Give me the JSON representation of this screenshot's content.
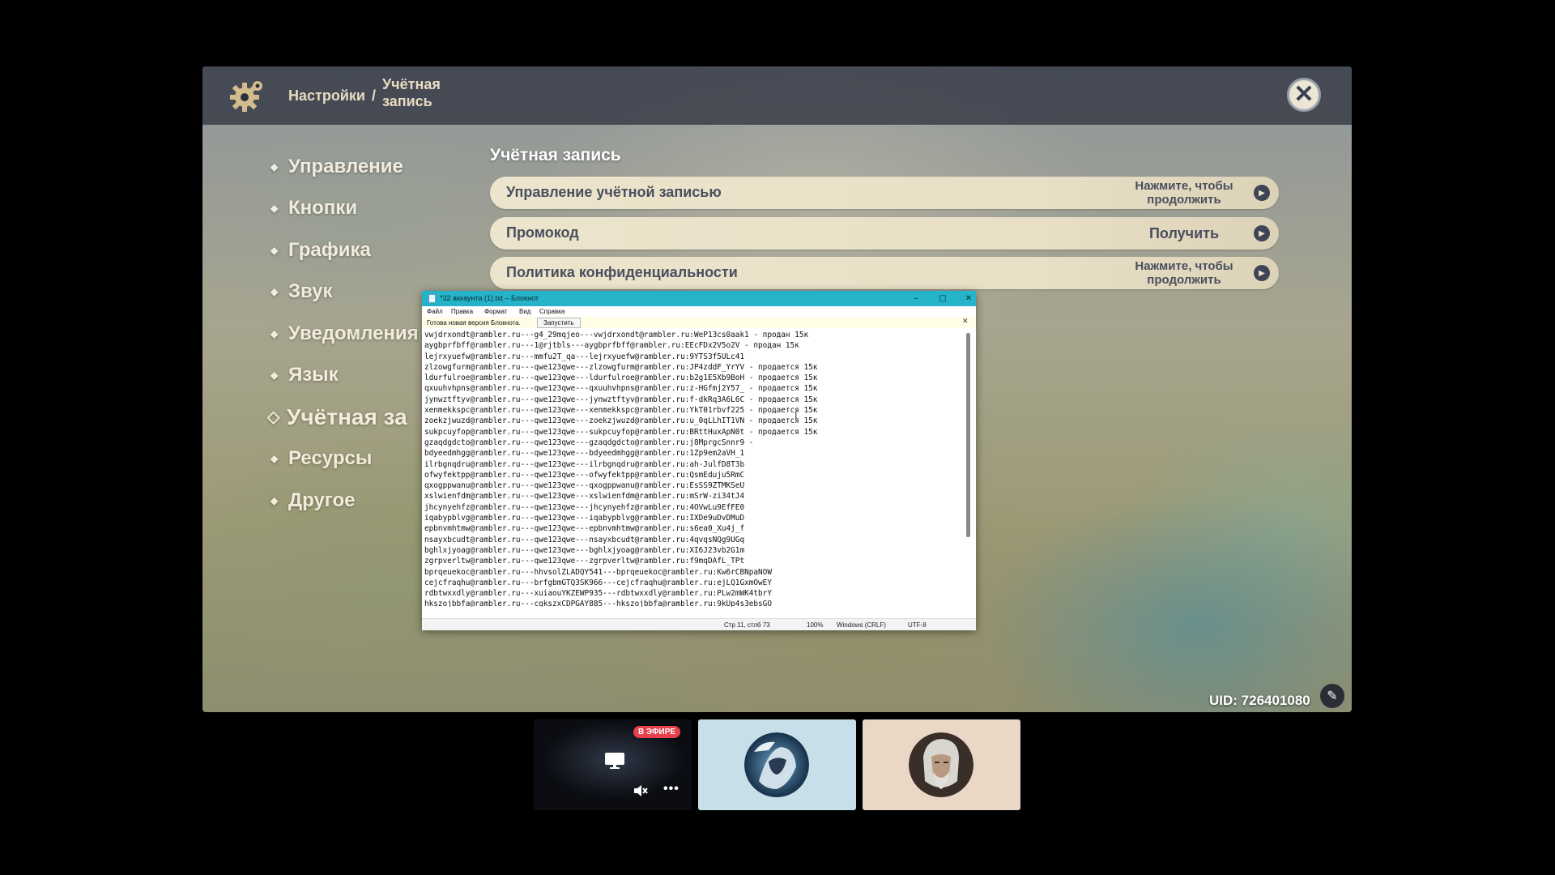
{
  "header": {
    "crumb_root": "Настройки",
    "crumb_sep": "/",
    "crumb_current": "Учётная запись"
  },
  "menu": {
    "items": [
      {
        "label": "Управление",
        "active": false
      },
      {
        "label": "Кнопки",
        "active": false
      },
      {
        "label": "Графика",
        "active": false
      },
      {
        "label": "Звук",
        "active": false
      },
      {
        "label": "Уведомления",
        "active": false
      },
      {
        "label": "Язык",
        "active": false
      },
      {
        "label": "Учётная за",
        "active": true
      },
      {
        "label": "Ресурсы",
        "active": false
      },
      {
        "label": "Другое",
        "active": false
      }
    ]
  },
  "section": {
    "title": "Учётная запись",
    "options": [
      {
        "label": "Управление учётной записью",
        "action": "Нажмите, чтобы продолжить"
      },
      {
        "label": "Промокод",
        "action": "Получить"
      },
      {
        "label": "Политика конфиденциальности",
        "action": "Нажмите, чтобы продолжить"
      }
    ]
  },
  "uid": "UID: 726401080",
  "notepad": {
    "title": "*32 аккаунта (1).txt – Блокнот",
    "menu": [
      "Файл",
      "Правка",
      "Формат",
      "Вид",
      "Справка"
    ],
    "notice": "Готова новая версия Блокнота.",
    "notice_button": "Запустить",
    "lines": [
      "vwjdrxondt@rambler.ru---g4_29mqjeo---vwjdrxondt@rambler.ru:WeP13cs0aak1 - продан 15к",
      "aygbprfbff@rambler.ru---1@rjtbls---aygbprfbff@rambler.ru:EEcFDx2V5o2V - продан 15к",
      "lejrxyuefw@rambler.ru---mmfu2T_qa---lejrxyuefw@rambler.ru:9YTS3f5ULc41",
      "zlzowgfurm@rambler.ru---qwe123qwe---zlzowgfurm@rambler.ru:JP4zddF_YrYV - продается 15к",
      "ldurfulroe@rambler.ru---qwe123qwe---ldurfulroe@rambler.ru:b2g1E5Xb9BoH - продается 15к",
      "qxuuhvhpns@rambler.ru---qwe123qwe---qxuuhvhpns@rambler.ru:z-HGfmj2Y57_ - продается 15к",
      "jynwztftyv@rambler.ru---qwe123qwe---jynwztftyv@rambler.ru:f-dkRq3A6L6C - продается 15к",
      "xenmekkspc@rambler.ru---qwe123qwe---xenmekkspc@rambler.ru:YkT01rbvf225 - продается 15к",
      "zoekzjwuzd@rambler.ru---qwe123qwe---zoekzjwuzd@rambler.ru:u_0qLLhIT1VN - продается 15к",
      "sukpcuyfop@rambler.ru---qwe123qwe---sukpcuyfop@rambler.ru:BRttHuxApN0t - продается 15к",
      "gzaqdgdcto@rambler.ru---qwe123qwe---gzaqdgdcto@rambler.ru:j8MprgcSnnr9 -",
      "bdyeedmhgg@rambler.ru---qwe123qwe---bdyeedmhgg@rambler.ru:1Zp9em2aVH_1",
      "ilrbgnqdru@rambler.ru---qwe123qwe---ilrbgnqdru@rambler.ru:ah-JulfD8T3b",
      "ofwyfektpp@rambler.ru---qwe123qwe---ofwyfektpp@rambler.ru:QsmEduju5RmC",
      "qxogppwanu@rambler.ru---qwe123qwe---qxogppwanu@rambler.ru:EsSS9ZTMKSeU",
      "xslwienfdm@rambler.ru---qwe123qwe---xslwienfdm@rambler.ru:mSrW-zi34tJ4",
      "jhcynyehfz@rambler.ru---qwe123qwe---jhcynyehfz@rambler.ru:4OVwLu9EfFE0",
      "iqabypblvg@rambler.ru---qwe123qwe---iqabypblvg@rambler.ru:IXDe9uDvDMuD",
      "epbnvmhtmw@rambler.ru---qwe123qwe---epbnvmhtmw@rambler.ru:s6ea0_Xu4j_f",
      "nsayxbcudt@rambler.ru---qwe123qwe---nsayxbcudt@rambler.ru:4qvqsNQg9UGq",
      "bghlxjyoag@rambler.ru---qwe123qwe---bghlxjyoag@rambler.ru:XI6J23vb2G1m",
      "zgrpverltw@rambler.ru---qwe123qwe---zgrpverltw@rambler.ru:f9mqDAfL_TPt",
      "bprqeuekoc@rambler.ru---hhvsolZLADQY541---bprqeuekoc@rambler.ru:Kw6rCBNpaNOW",
      "cejcfraqhu@rambler.ru---brfgbmGTQ3SK966---cejcfraqhu@rambler.ru:ejLQ1GxmOwEY",
      "rdbtwxxdly@rambler.ru---xuiaouYKZEWP935---rdbtwxxdly@rambler.ru:PLw2mWK4tbrY",
      "hkszojbbfa@rambler.ru---cgkszxCDPGAY885---hkszojbbfa@rambler.ru:9kUp4s3ebsGO"
    ],
    "status": {
      "position": "Стр 11, стлб 73",
      "zoom": "100%",
      "line_endings": "Windows (CRLF)",
      "encoding": "UTF-8"
    }
  },
  "stream": {
    "live_badge": "В ЭФИРЕ"
  }
}
